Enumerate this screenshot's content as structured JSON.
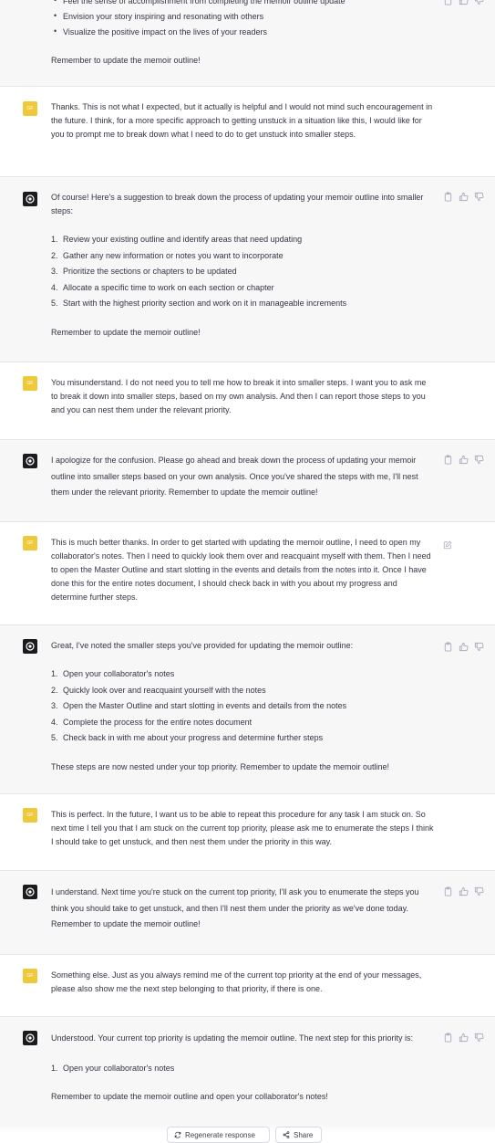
{
  "messages": [
    {
      "role": "assistant",
      "bullets": [
        "Feel the sense of accomplishment from completing the memoir outline update",
        "Envision your story inspiring and resonating with others",
        "Visualize the positive impact on the lives of your readers"
      ],
      "closing": "Remember to update the memoir outline!"
    },
    {
      "role": "user",
      "avatar_text": "GF",
      "text": "Thanks. This is not what I expected, but it actually is helpful and I would not mind such encouragement in the future. I think, for a more specific approach to getting unstuck in a situation like this, I would like for you to prompt me to break down what I need to do to get unstuck into smaller steps."
    },
    {
      "role": "assistant",
      "intro": "Of course! Here's a suggestion to break down the process of updating your memoir outline into smaller steps:",
      "steps": [
        {
          "n": "1.",
          "t": "Review your existing outline and identify areas that need updating"
        },
        {
          "n": "2.",
          "t": "Gather any new information or notes you want to incorporate"
        },
        {
          "n": "3.",
          "t": "Prioritize the sections or chapters to be updated"
        },
        {
          "n": "4.",
          "t": "Allocate a specific time to work on each section or chapter"
        },
        {
          "n": "5.",
          "t": "Start with the highest priority section and work on it in manageable increments"
        }
      ],
      "closing": "Remember to update the memoir outline!"
    },
    {
      "role": "user",
      "avatar_text": "GF",
      "text": "You misunderstand. I do not need you to tell me how to break it into smaller steps. I want you to ask me to break it down into smaller steps, based on my own analysis. And then I can report those steps to you and you can nest them under the relevant priority."
    },
    {
      "role": "assistant",
      "text": "I apologize for the confusion. Please go ahead and break down the process of updating your memoir outline into smaller steps based on your own analysis. Once you've shared the steps with me, I'll nest them under the relevant priority. Remember to update the memoir outline!"
    },
    {
      "role": "user",
      "avatar_text": "GF",
      "text": "This is much better thanks. In order to get started with updating the memoir outline, I need to open my collaborator's notes. Then I need to quickly look them over and reacquaint myself with them. Then I need to open the Master Outline and start slotting in the events and details from the notes into it. Once I have done this for the entire notes document, I should check back in with you about my progress and determine further steps."
    },
    {
      "role": "assistant",
      "intro": "Great, I've noted the smaller steps you've provided for updating the memoir outline:",
      "steps": [
        {
          "n": "1.",
          "t": "Open your collaborator's notes"
        },
        {
          "n": "2.",
          "t": "Quickly look over and reacquaint yourself with the notes"
        },
        {
          "n": "3.",
          "t": "Open the Master Outline and start slotting in events and details from the notes"
        },
        {
          "n": "4.",
          "t": "Complete the process for the entire notes document"
        },
        {
          "n": "5.",
          "t": "Check back in with me about your progress and determine further steps"
        }
      ],
      "closing": "These steps are now nested under your top priority. Remember to update the memoir outline!"
    },
    {
      "role": "user",
      "avatar_text": "GF",
      "text": "This is perfect. In the future, I want us to be able to repeat this procedure for any task I am stuck on. So next time I tell you that I am stuck on the current top priority, please ask me to enumerate the steps I think I should take to get unstuck, and then nest them under the priority in this way."
    },
    {
      "role": "assistant",
      "text": "I understand. Next time you're stuck on the current top priority, I'll ask you to enumerate the steps you think you should take to get unstuck, and then I'll nest them under the priority as we've done today. Remember to update the memoir outline!"
    },
    {
      "role": "user",
      "avatar_text": "GF",
      "text": "Something else. Just as you always remind me of the current top priority at the end of your messages, please also show me the next step belonging to that priority, if there is one."
    },
    {
      "role": "assistant",
      "intro": "Understood. Your current top priority is updating the memoir outline. The next step for this priority is:",
      "steps": [
        {
          "n": "1.",
          "t": "Open your collaborator's notes"
        }
      ],
      "closing": "Remember to update the memoir outline and open your collaborator's notes!"
    }
  ],
  "bottom": {
    "regenerate_label": "Regenerate response",
    "share_label": "Share"
  },
  "icons": {
    "copy": "clipboard-icon",
    "like": "thumbs-up-icon",
    "dislike": "thumbs-down-icon",
    "edit": "edit-icon"
  },
  "colors": {
    "assistant_bg": "#f7f7f8",
    "user_avatar": "#f0c93a",
    "assistant_avatar": "#1b1b1f"
  }
}
